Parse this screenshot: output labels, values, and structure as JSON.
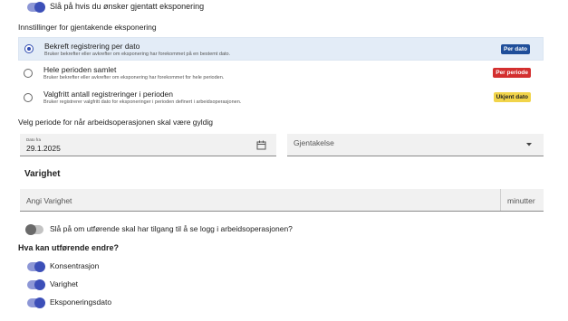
{
  "repeat_toggle": {
    "label": "Slå på hvis du ønsker gjentatt eksponering",
    "on": true
  },
  "settings_heading": "Innstillinger for gjentakende eksponering",
  "options": [
    {
      "title": "Bekreft registrering per dato",
      "description": "Bruker bekrefter eller avkrefter om eksponering har forekommet på en bestemt dato.",
      "badge": "Per dato",
      "selected": true
    },
    {
      "title": "Hele perioden samlet",
      "description": "Bruker bekrefter eller avkrefter om eksponering har forekommet for hele perioden.",
      "badge": "Per periode",
      "selected": false
    },
    {
      "title": "Valgfritt antall registreringer i perioden",
      "description": "Bruker registrerer valgfritt dato for eksponeringer i perioden definert i arbeidsoperasjonen.",
      "badge": "Ukjent dato",
      "selected": false
    }
  ],
  "badge_colors": {
    "per_dato": "#1f4e9a",
    "per_periode": "#d32f2f",
    "ukjent_dato": "#f1d44a"
  },
  "period_heading": "Velg periode for når arbeidsoperasjonen skal være gyldig",
  "date_field": {
    "label": "Dato fra",
    "value": "29.1.2025",
    "icon": "calendar-icon"
  },
  "repeat_select": {
    "placeholder": "Gjentakelse",
    "icon": "dropdown-arrow-icon"
  },
  "duration": {
    "heading": "Varighet",
    "placeholder": "Angi Varighet",
    "unit": "minutter"
  },
  "log_toggle": {
    "label": "Slå på om utførende skal har tilgang til å se logg i arbeidsoperasjonen?",
    "on": false
  },
  "edit_heading": "Hva kan utførende endre?",
  "editable_toggles": [
    {
      "label": "Konsentrasjon",
      "on": true
    },
    {
      "label": "Varighet",
      "on": true
    },
    {
      "label": "Eksponeringsdato",
      "on": true
    }
  ],
  "accent_color": "#3c4fb8"
}
